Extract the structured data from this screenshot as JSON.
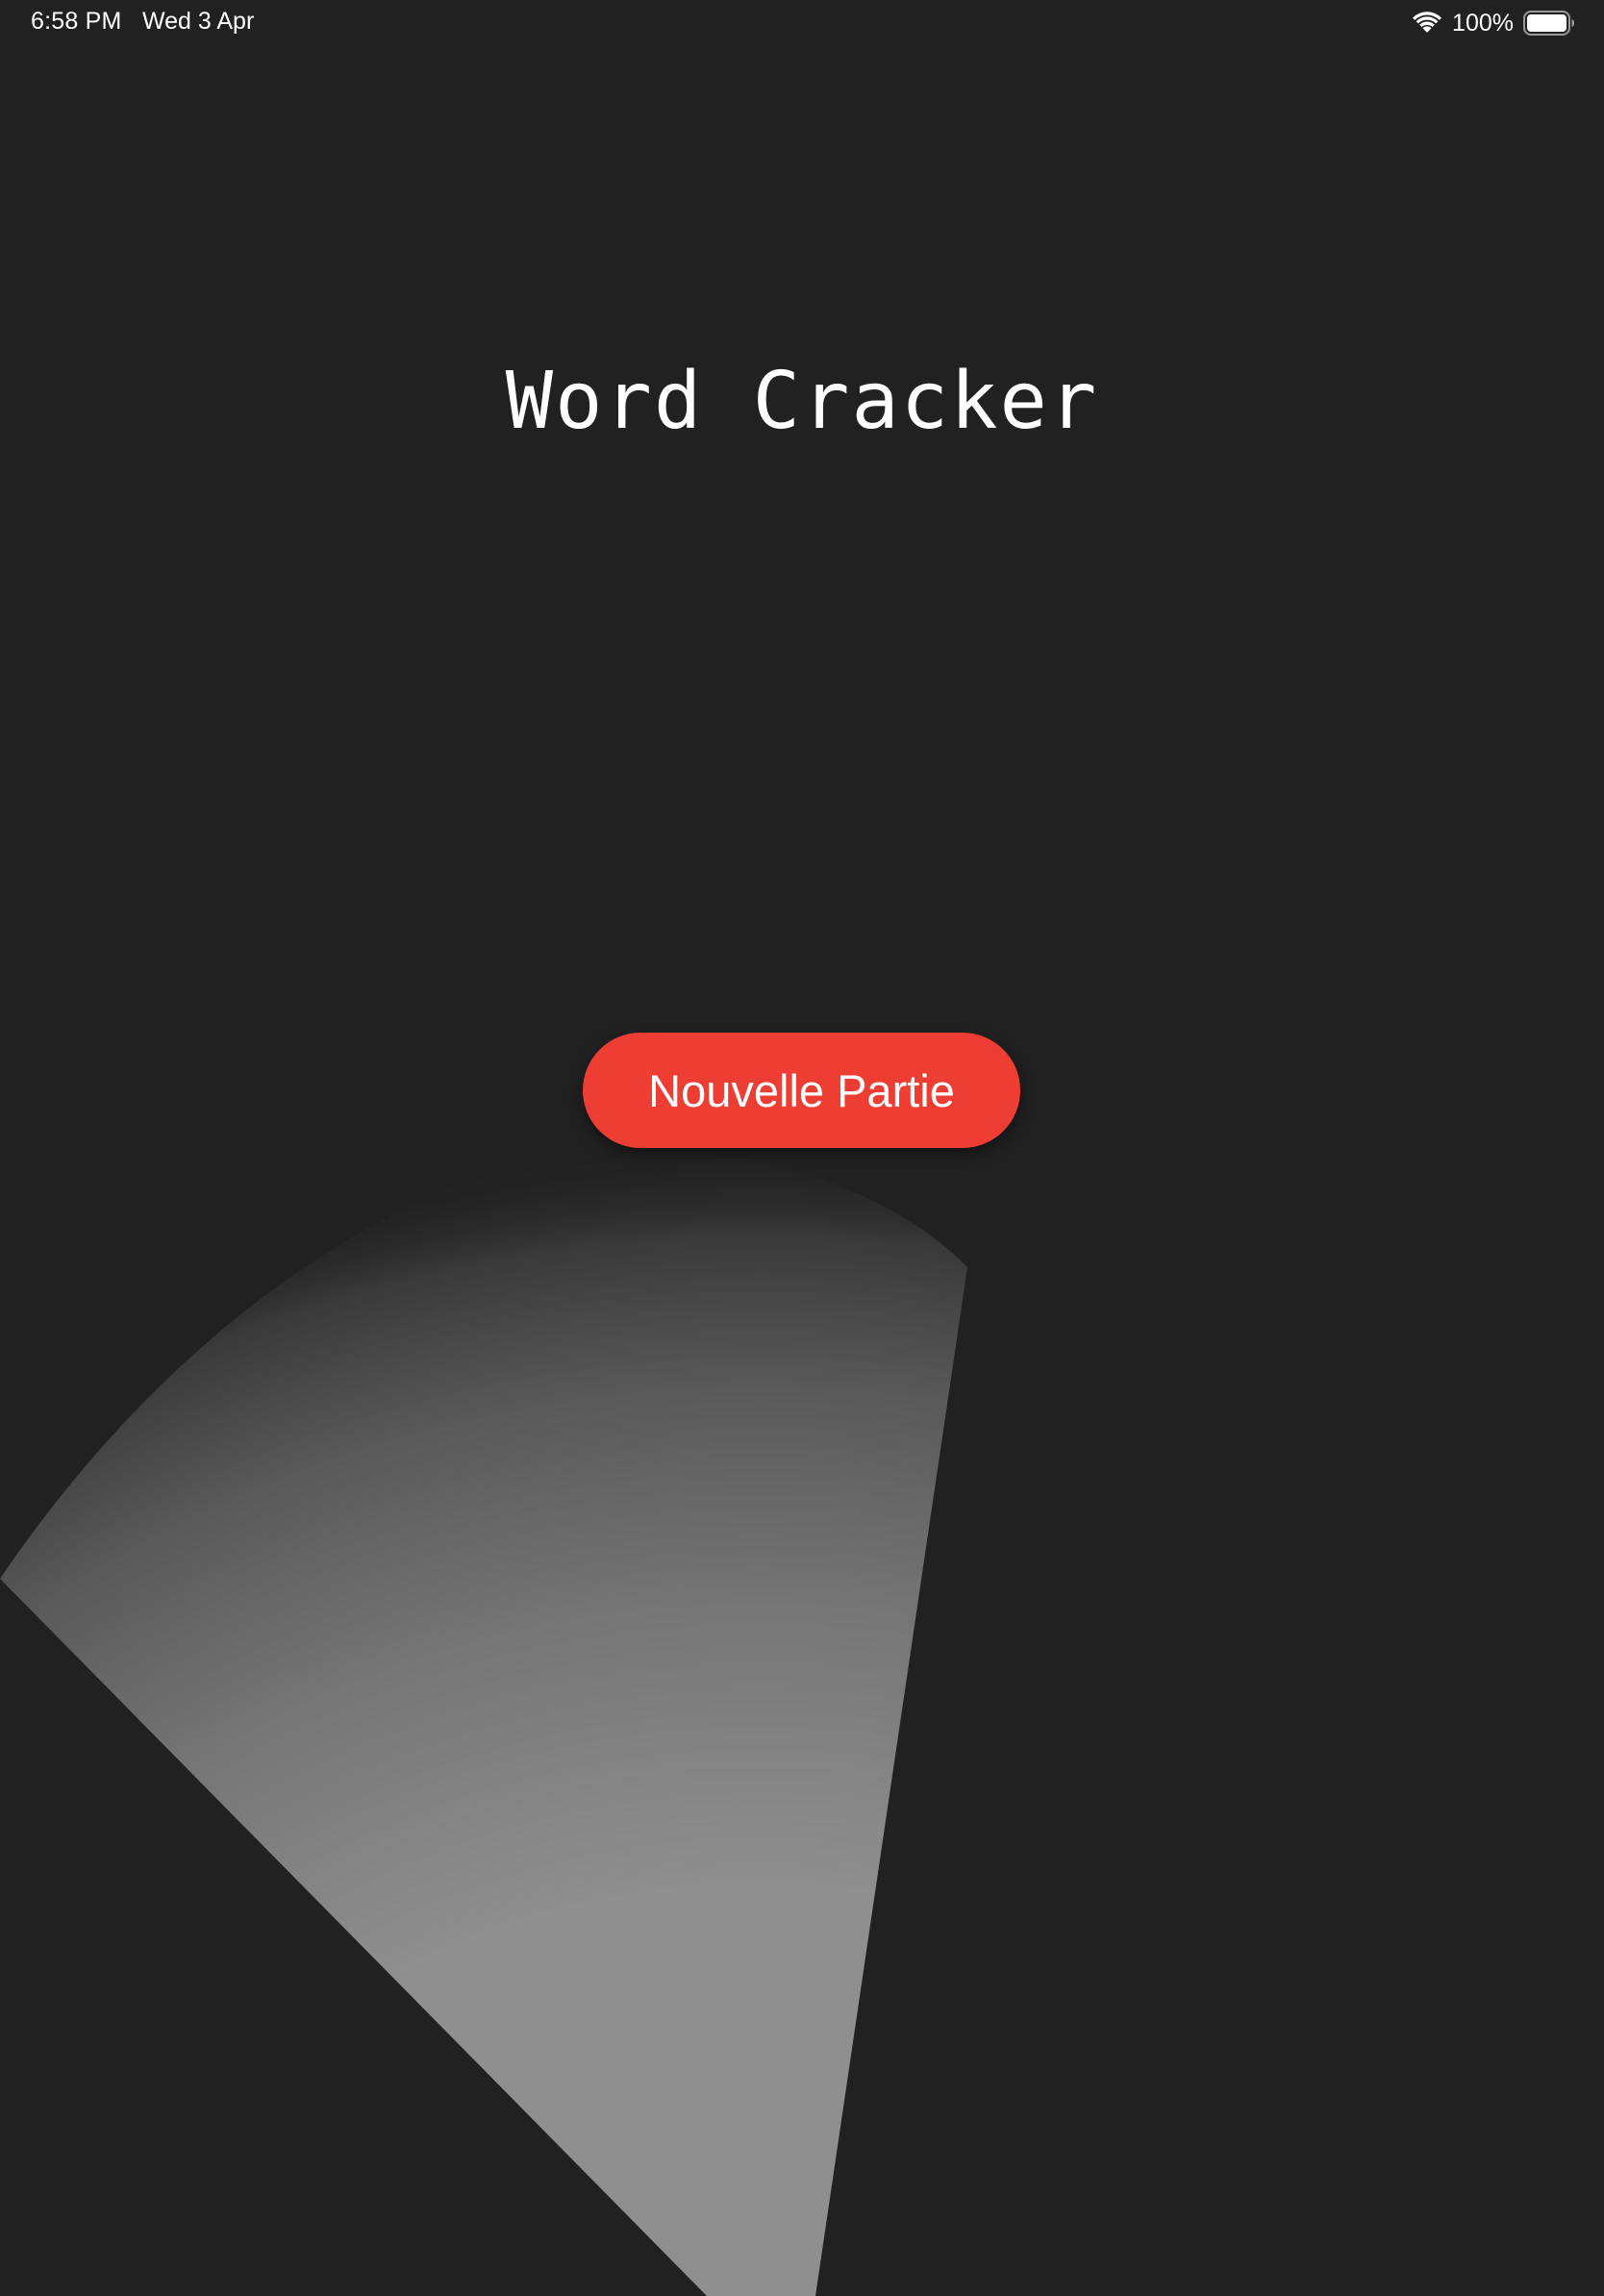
{
  "status_bar": {
    "time": "6:58 PM",
    "date": "Wed 3 Apr",
    "battery_percent": "100%",
    "wifi_icon": "wifi-icon",
    "battery_icon": "battery-icon",
    "battery_level": 1.0
  },
  "title": "Word Cracker",
  "new_game_button": {
    "label": "Nouvelle Partie"
  },
  "colors": {
    "background": "#212121",
    "accent": "#ee3d33",
    "text": "#ffffff"
  }
}
